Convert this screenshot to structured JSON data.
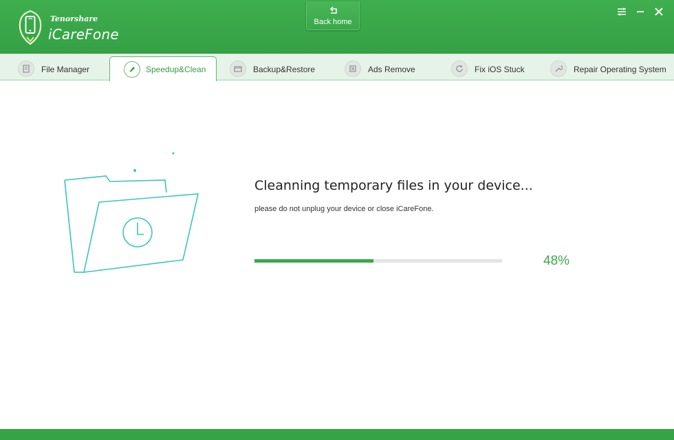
{
  "header": {
    "brand_small": "Tenorshare",
    "brand_name": "iCareFone",
    "back_home_label": "Back home",
    "colors": {
      "header_green": "#3fae4e",
      "accent": "#38a94a"
    }
  },
  "window_controls": [
    {
      "name": "menu-icon"
    },
    {
      "name": "minimize-icon"
    },
    {
      "name": "close-icon"
    }
  ],
  "tabs": [
    {
      "label": "File Manager",
      "icon": "file-manager-icon",
      "active": false
    },
    {
      "label": "Speedup&Clean",
      "icon": "brush-icon",
      "active": true
    },
    {
      "label": "Backup&Restore",
      "icon": "backup-icon",
      "active": false
    },
    {
      "label": "Ads Remove",
      "icon": "ads-remove-icon",
      "active": false
    },
    {
      "label": "Fix iOS Stuck",
      "icon": "refresh-icon",
      "active": false
    },
    {
      "label": "Repair Operating System",
      "icon": "wrench-icon",
      "active": false
    }
  ],
  "main": {
    "title": "Cleanning temporary files in your device...",
    "subtitle": "please do not unplug your device or close iCareFone.",
    "progress_percent": 48,
    "progress_label": "48%"
  }
}
